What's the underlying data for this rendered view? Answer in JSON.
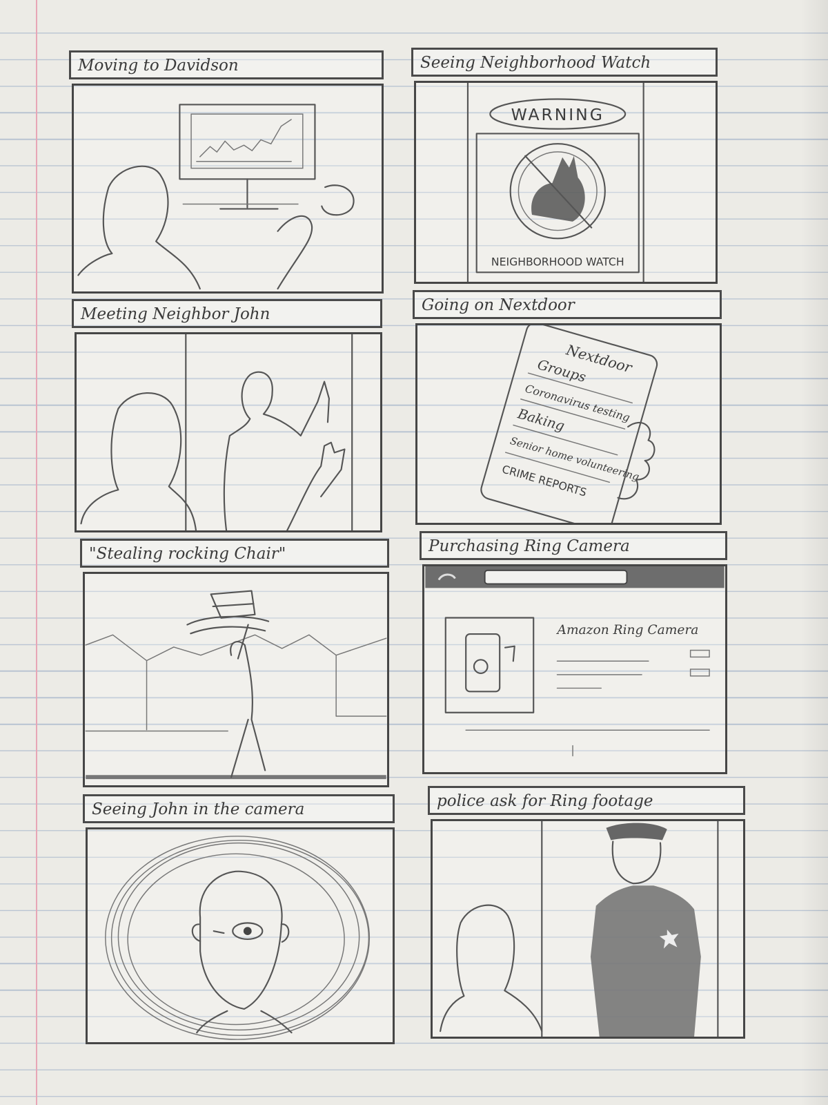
{
  "panels": [
    {
      "title": "Moving to Davidson"
    },
    {
      "title": "Seeing Neighborhood Watch",
      "sign_top": "WARNING",
      "sign_bottom": "NEIGHBORHOOD WATCH"
    },
    {
      "title": "Meeting Neighbor John"
    },
    {
      "title": "Going on Nextdoor",
      "app_name": "Nextdoor",
      "list_items": [
        "Groups",
        "Coronavirus testing",
        "Baking",
        "Senior home volunteering",
        "CRIME REPORTS"
      ]
    },
    {
      "title": "\"Stealing rocking Chair\""
    },
    {
      "title": "Purchasing Ring Camera",
      "product_name": "Amazon Ring Camera"
    },
    {
      "title": "Seeing John in the camera"
    },
    {
      "title": "police ask for Ring footage"
    }
  ]
}
